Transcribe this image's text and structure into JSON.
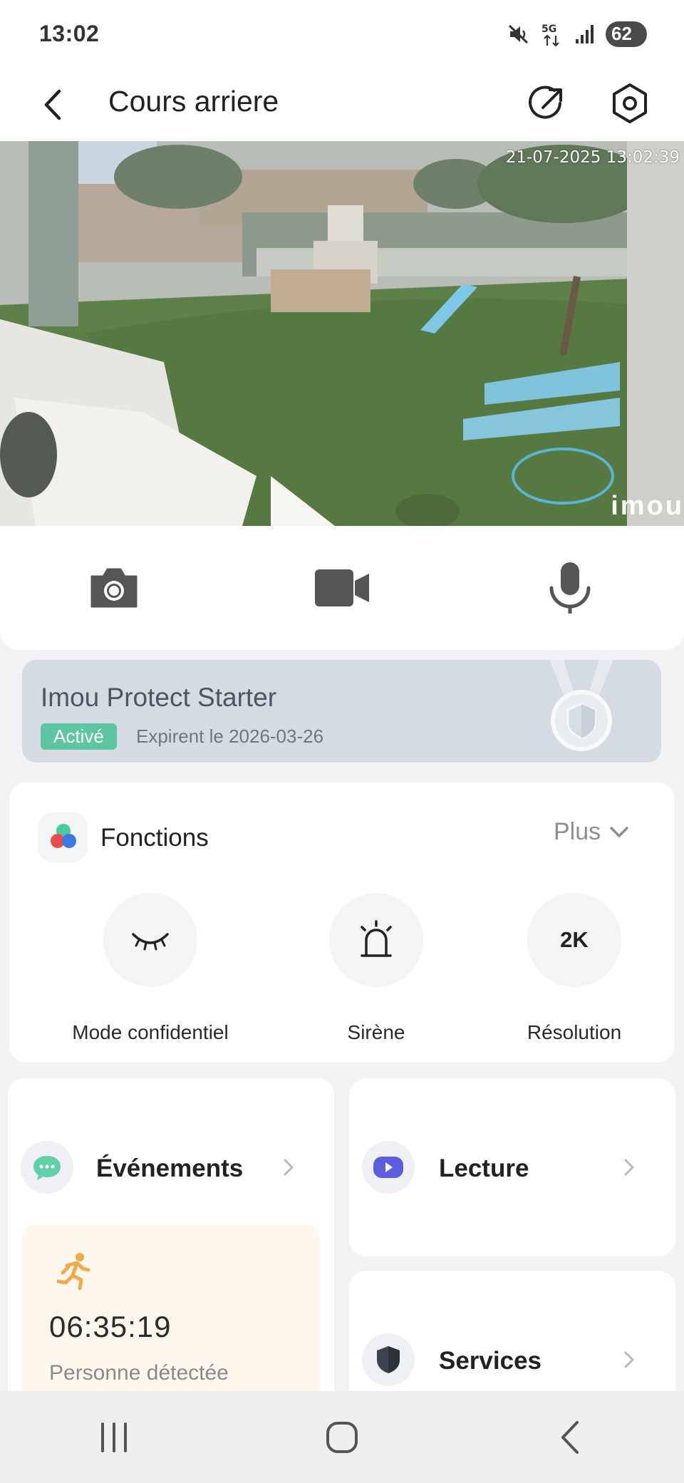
{
  "status_bar": {
    "time": "13:02",
    "network": "5G",
    "battery": "62"
  },
  "header": {
    "title": "Cours arriere"
  },
  "camera": {
    "timestamp": "21-07-2025 13:02:39",
    "watermark": "imou"
  },
  "controls": {
    "items": [
      {
        "icon": "camera-icon"
      },
      {
        "icon": "video-record-icon"
      },
      {
        "icon": "microphone-icon"
      }
    ]
  },
  "plan": {
    "name": "Imou Protect Starter",
    "badge": "Activé",
    "expiry": "Expirent le 2026-03-26"
  },
  "functions": {
    "title": "Fonctions",
    "more_label": "Plus",
    "items": [
      {
        "label": "Mode confidentiel",
        "icon": "closed-eye-icon"
      },
      {
        "label": "Sirène",
        "icon": "siren-icon"
      },
      {
        "label": "Résolution",
        "icon": "resolution-icon",
        "icon_text": "2K"
      }
    ]
  },
  "tiles": {
    "events": {
      "label": "Événements",
      "icon": "chat-bubble-icon"
    },
    "playback": {
      "label": "Lecture",
      "icon": "play-icon"
    },
    "services": {
      "label": "Services",
      "icon": "shield-icon"
    }
  },
  "latest_event": {
    "time": "06:35:19",
    "type": "Personne détectée",
    "icon": "running-person-icon"
  },
  "colors": {
    "badge_green": "#5dc6a0",
    "event_orange": "#f2a94a",
    "playback_purple": "#5b5ce0",
    "chat_green": "#5fd0a8"
  }
}
